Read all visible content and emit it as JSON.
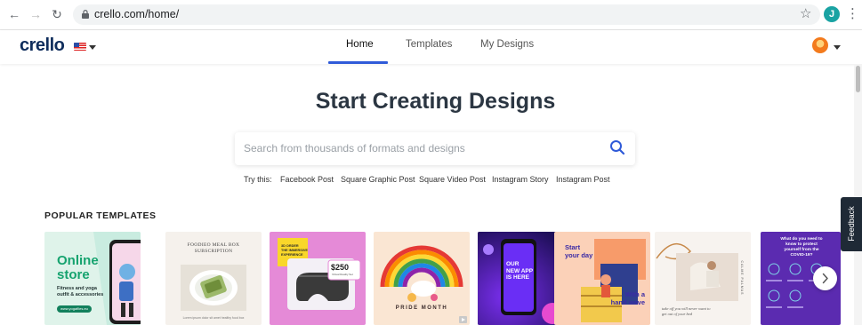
{
  "browser": {
    "url": "crello.com/home/",
    "profile_initial": "J"
  },
  "header": {
    "logo": "crello",
    "tabs": [
      {
        "label": "Home",
        "active": true
      },
      {
        "label": "Templates",
        "active": false
      },
      {
        "label": "My Designs",
        "active": false
      }
    ]
  },
  "main": {
    "headline": "Start Creating Designs",
    "search_placeholder": "Search from thousands of formats and designs",
    "try_label": "Try this:",
    "suggestions": [
      "Facebook Post",
      "Square Graphic Post",
      "Square Video Post",
      "Instagram Story",
      "Instagram Post"
    ],
    "section_title": "POPULAR TEMPLATES"
  },
  "templates": [
    {
      "id": "online-store",
      "bg": "#dff3ea",
      "title_lines": [
        "Online",
        "store"
      ],
      "sub_lines": [
        "Fitness and yoga",
        "outfit & accessories"
      ],
      "button": "www.yogafiles.eu"
    },
    {
      "id": "food-box",
      "bg": "#f5f1ec",
      "title_lines": [
        "FOODIEO MEAL BOX",
        "SUBSCRIPTION"
      ],
      "caption": "Lorem ipsum dolor sit amet healthy food box"
    },
    {
      "id": "vr-sale",
      "bg": "#e58ad7",
      "tag_lines": [
        "3D ORDER",
        "THE IMMERSIVE",
        "EXPERIENCE"
      ],
      "price": "$250",
      "price_sub": "Virtual Reality Set"
    },
    {
      "id": "pride-month",
      "bg": "#fae6d3",
      "title": "PRIDE MONTH"
    },
    {
      "id": "new-app",
      "bg": "#3a1f8a",
      "lines": [
        "OUR",
        "NEW APP",
        "IS HERE"
      ]
    },
    {
      "id": "start-day",
      "bg": "#fbd1b8",
      "title_lines": [
        "Start",
        "your day"
      ],
      "sub_lines": [
        "With a",
        "hand wave"
      ]
    },
    {
      "id": "calm-palmas",
      "bg": "#f7f3ef",
      "side_text": "CALME PALMAS",
      "quote": "take off you will never want to get out of your bed"
    },
    {
      "id": "covid",
      "bg": "#5b2bb0",
      "title_lines": [
        "What do you need to",
        "know to protect",
        "yourself from the",
        "COVID-19?"
      ]
    }
  ],
  "feedback_label": "Feedback",
  "colors": {
    "accent": "#2f5ad8",
    "logo": "#0f2d5c",
    "headline": "#2b3642"
  }
}
